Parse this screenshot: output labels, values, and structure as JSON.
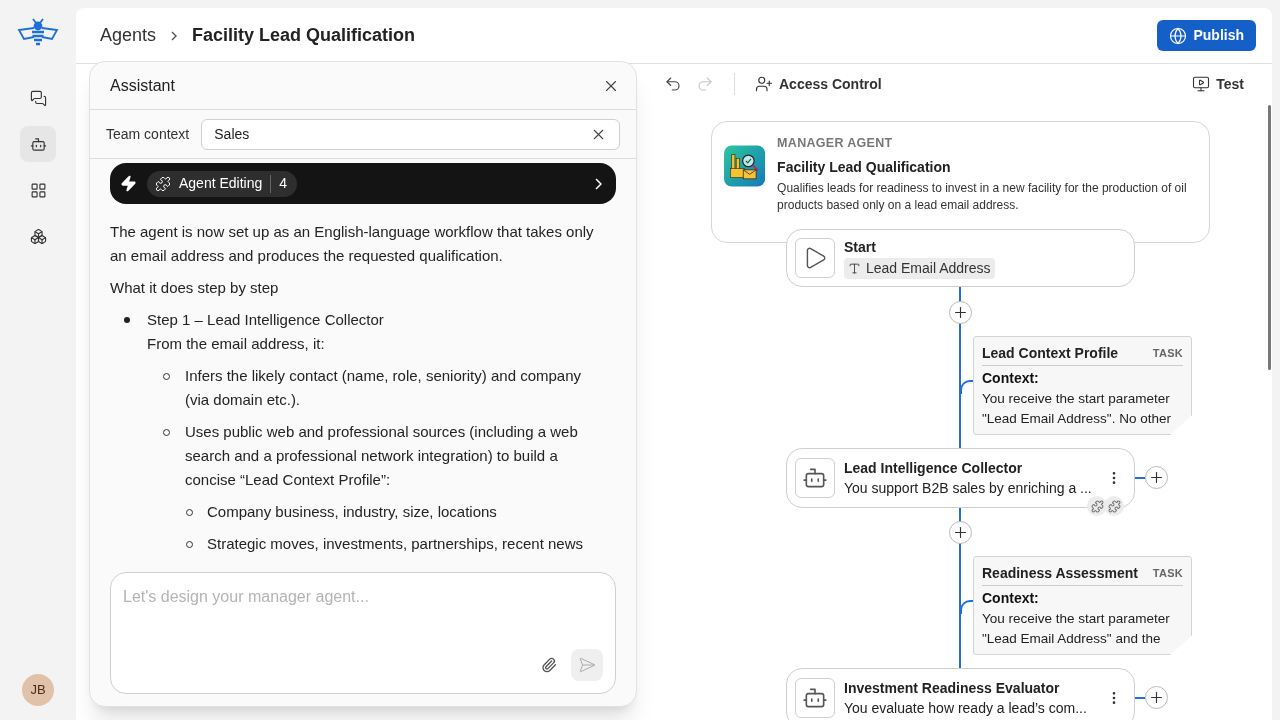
{
  "nav": [
    {
      "selected": false
    },
    {
      "selected": true
    },
    {
      "selected": false
    },
    {
      "selected": false
    }
  ],
  "user": {
    "initials": "JB"
  },
  "breadcrumb": {
    "parent": "Agents",
    "current": "Facility Lead Qualification"
  },
  "publish_button": "Publish",
  "toolbar": {
    "undo": {
      "disabled": false
    },
    "redo": {
      "disabled": true
    },
    "access_control": "Access Control",
    "test": "Test"
  },
  "assistant": {
    "title": "Assistant",
    "team_context": {
      "label": "Team context",
      "value": "Sales"
    },
    "skill_bar": {
      "label": "Agent Editing",
      "count": "4"
    },
    "message": [
      {
        "kind": "paragraph",
        "text": "The agent is now set up as an English-language workflow that takes only an email address and produces the requested qualification."
      },
      {
        "kind": "paragraph",
        "text": "What it does step by step"
      },
      {
        "kind": "list",
        "items": [
          {
            "text": "Step 1 – Lead Intelligence Collector",
            "detail": "From the email address, it:",
            "children": [
              {
                "text": "Infers the likely contact (name, role, seniority) and company (via domain etc.)."
              },
              {
                "text": "Uses public web and professional sources (including a web search and a professional network integration) to build a concise “Lead Context Profile”:",
                "children": [
                  {
                    "text": "Company business, industry, size, locations"
                  },
                  {
                    "text": "Strategic moves, investments, partnerships, recent news"
                  }
                ]
              }
            ]
          }
        ]
      }
    ],
    "composer": {
      "placeholder": "Let's design your manager agent..."
    }
  },
  "flow": {
    "manager": {
      "kicker": "MANAGER AGENT",
      "title": "Facility Lead Qualification",
      "description": "Qualifies leads for readiness to invest in a new facility for the production of oil products based only on a lead email address."
    },
    "start": {
      "title": "Start",
      "parameter": "Lead Email Address"
    },
    "steps": [
      {
        "kind": "task",
        "title": "Lead Context Profile",
        "badge": "TASK",
        "heading": "Context:",
        "text": "You receive the start parameter \"Lead Email Address\". No other"
      },
      {
        "kind": "agent",
        "title": "Lead Intelligence Collector",
        "description": "You support B2B sales by enriching a ...",
        "skills": true
      },
      {
        "kind": "task",
        "title": "Readiness Assessment",
        "badge": "TASK",
        "heading": "Context:",
        "text": "You receive the start parameter \"Lead Email Address\" and the"
      },
      {
        "kind": "agent",
        "title": "Investment Readiness Evaluator",
        "description": "You evaluate how ready a lead’s com...",
        "skills": false
      }
    ]
  }
}
